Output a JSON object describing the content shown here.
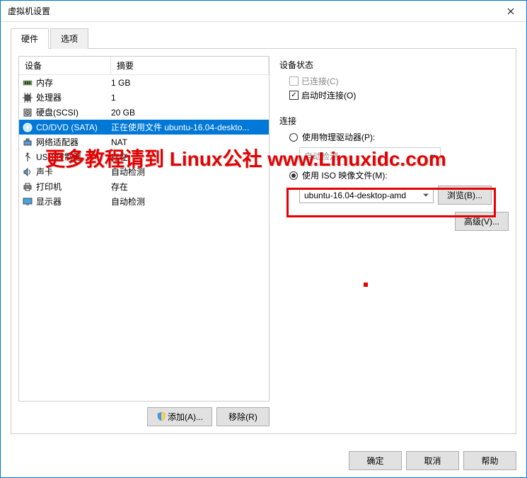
{
  "window": {
    "title": "虚拟机设置"
  },
  "tabs": {
    "hardware": "硬件",
    "options": "选项"
  },
  "table": {
    "header_device": "设备",
    "header_summary": "摘要",
    "rows": [
      {
        "name": "内存",
        "summary": "1 GB",
        "icon": "memory"
      },
      {
        "name": "处理器",
        "summary": "1",
        "icon": "cpu"
      },
      {
        "name": "硬盘(SCSI)",
        "summary": "20 GB",
        "icon": "disk"
      },
      {
        "name": "CD/DVD (SATA)",
        "summary": "正在使用文件 ubuntu-16.04-deskto...",
        "icon": "cd",
        "selected": true
      },
      {
        "name": "网络适配器",
        "summary": "NAT",
        "icon": "net"
      },
      {
        "name": "USB 控制器",
        "summary": "存在",
        "icon": "usb"
      },
      {
        "name": "声卡",
        "summary": "自动检测",
        "icon": "sound"
      },
      {
        "name": "打印机",
        "summary": "存在",
        "icon": "printer"
      },
      {
        "name": "显示器",
        "summary": "自动检测",
        "icon": "display"
      }
    ]
  },
  "left_buttons": {
    "add": "添加(A)...",
    "remove": "移除(R)"
  },
  "right": {
    "status_label": "设备状态",
    "connected": "已连接(C)",
    "connect_on_start": "启动时连接(O)",
    "connection_label": "连接",
    "physical": "使用物理驱动器(P):",
    "physical_value": "自动检测",
    "iso": "使用 ISO 映像文件(M):",
    "iso_value": "ubuntu-16.04-desktop-amd",
    "browse": "浏览(B)...",
    "advanced": "高级(V)..."
  },
  "footer": {
    "ok": "确定",
    "cancel": "取消",
    "help": "帮助"
  },
  "watermark": "更多教程请到 Linux公社 www.Linuxidc.com"
}
